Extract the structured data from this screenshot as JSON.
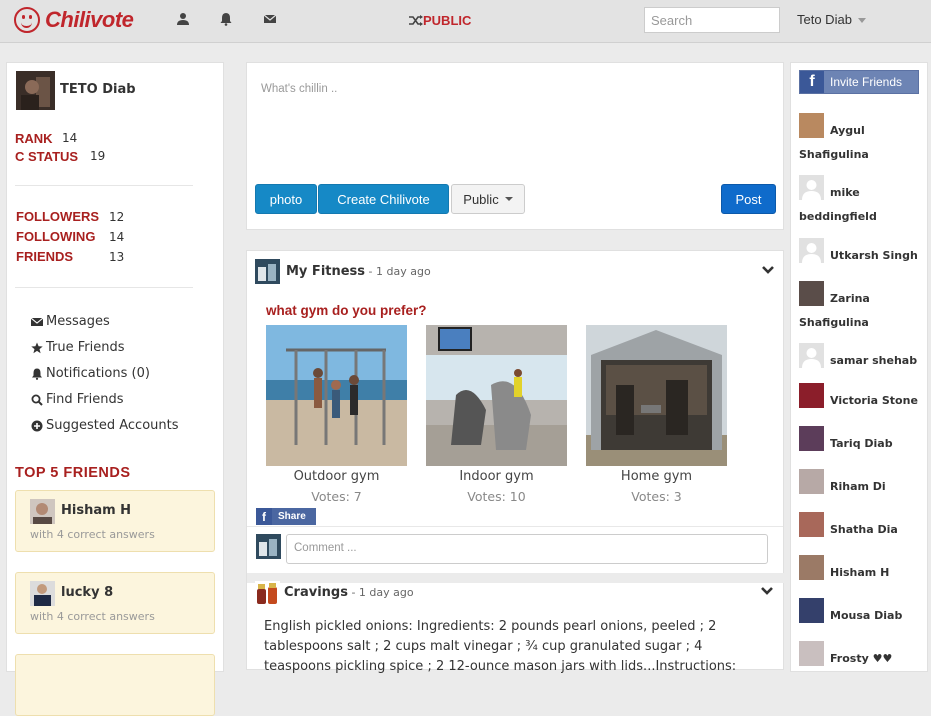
{
  "topbar": {
    "brand": "Chilivote",
    "public_label": "PUBLIC",
    "search_placeholder": "Search",
    "user_name": "Teto Diab",
    "nav_icons": [
      "user-icon",
      "bell-icon",
      "envelope-icon"
    ]
  },
  "profile": {
    "name": "TETO Diab",
    "rank_label": "RANK",
    "rank_value": "14",
    "cstatus_label": "C STATUS",
    "cstatus_value": "19",
    "followers_label": "FOLLOWERS",
    "followers_value": "12",
    "following_label": "FOLLOWING",
    "following_value": "14",
    "friends_label": "FRIENDS",
    "friends_value": "13"
  },
  "sidebar_menu": [
    {
      "icon": "envelope-icon",
      "label": "Messages"
    },
    {
      "icon": "star-icon",
      "label": "True Friends"
    },
    {
      "icon": "bell-icon",
      "label": "Notifications (0)"
    },
    {
      "icon": "search-icon",
      "label": "Find Friends"
    },
    {
      "icon": "plus-circle-icon",
      "label": "Suggested Accounts"
    }
  ],
  "top_friends": {
    "title": "TOP 5 FRIENDS",
    "items": [
      {
        "name": "Hisham H",
        "sub": "with 4 correct answers"
      },
      {
        "name": "lucky 8",
        "sub": "with 4 correct answers"
      }
    ]
  },
  "compose": {
    "placeholder": "What's chillin ..",
    "photo_label": "photo",
    "create_label": "Create Chilivote",
    "visibility_label": "Public",
    "post_label": "Post"
  },
  "post1": {
    "author": "My Fitness",
    "time": " - 1 day ago",
    "question": "what gym do you prefer?",
    "options": [
      {
        "label": "Outdoor gym",
        "votes": "Votes: 7"
      },
      {
        "label": "Indoor gym",
        "votes": "Votes: 10"
      },
      {
        "label": "Home gym",
        "votes": "Votes: 3"
      }
    ],
    "share_label": "Share",
    "comment_placeholder": "Comment ..."
  },
  "post2": {
    "author": "Cravings",
    "time": " - 1 day ago",
    "text": "English pickled onions: Ingredients: 2 pounds pearl onions, peeled ; 2 tablespoons salt ; 2 cups malt vinegar ; ¾ cup granulated sugar ; 4 teaspoons pickling spice ; 2 12-ounce mason jars with lids...Instructions:"
  },
  "right_panel": {
    "invite_label": "Invite Friends",
    "suggestions": [
      {
        "name": "Aygul Shafigulina",
        "color": "#b98960"
      },
      {
        "name": "mike beddingfield",
        "color": "default"
      },
      {
        "name": "Utkarsh Singh",
        "color": "default"
      },
      {
        "name": "Zarina Shafigulina",
        "color": "#5a4d49"
      },
      {
        "name": "samar shehab",
        "color": "default"
      },
      {
        "name": "Victoria Stone",
        "color": "#8b1e2a"
      },
      {
        "name": "Tariq Diab",
        "color": "#5c3d5a"
      },
      {
        "name": "Riham Di",
        "color": "#b7a9a6"
      },
      {
        "name": "Shatha Dia",
        "color": "#a8685a"
      },
      {
        "name": "Hisham H",
        "color": "#9b7a66"
      },
      {
        "name": "Mousa Diab",
        "color": "#34406b"
      },
      {
        "name": "Frosty ♥♥",
        "color": "#c9bfbf"
      }
    ]
  },
  "colors": {
    "accent": "#a8201f",
    "brand": "#c0262c",
    "button_blue": "#1689c6",
    "post_blue": "#0f6bcb"
  }
}
